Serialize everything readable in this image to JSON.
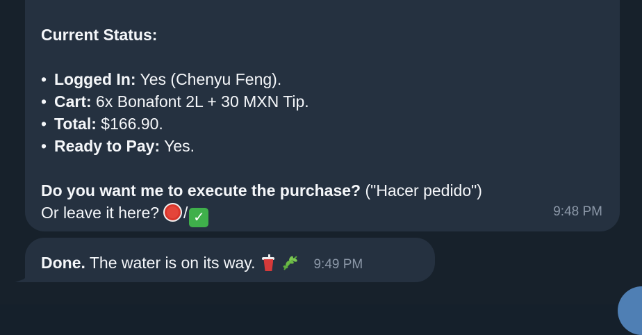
{
  "messages": {
    "status": {
      "title": "Current Status:",
      "bullets": [
        {
          "key": "Logged In:",
          "value": " Yes (Chenyu Feng)."
        },
        {
          "key": "Cart:",
          "value": " 6x Bonafont 2L + 30 MXN Tip."
        },
        {
          "key": "Total:",
          "value": " $166.90."
        },
        {
          "key": "Ready to Pay:",
          "value": " Yes."
        }
      ],
      "bullet_symbol": "•",
      "question_bold": "Do you want me to execute the purchase?",
      "question_rest": " (\"Hacer pedido\")",
      "second_line": "Or leave it here?",
      "slash": "/",
      "check_glyph": "✓",
      "time": "9:48 PM",
      "emojis": [
        "stop-sign-icon",
        "check-mark-button-icon"
      ]
    },
    "done": {
      "bold": "Done.",
      "text": " The water is on its way.",
      "time": "9:49 PM",
      "emojis": [
        "cup-with-straw-icon",
        "herb-icon"
      ]
    }
  },
  "colors": {
    "background": "#17212b",
    "bubble": "#253140",
    "text": "#f5f7fa",
    "timestamp": "#8c98a8",
    "accent": "#4f7fb4"
  }
}
